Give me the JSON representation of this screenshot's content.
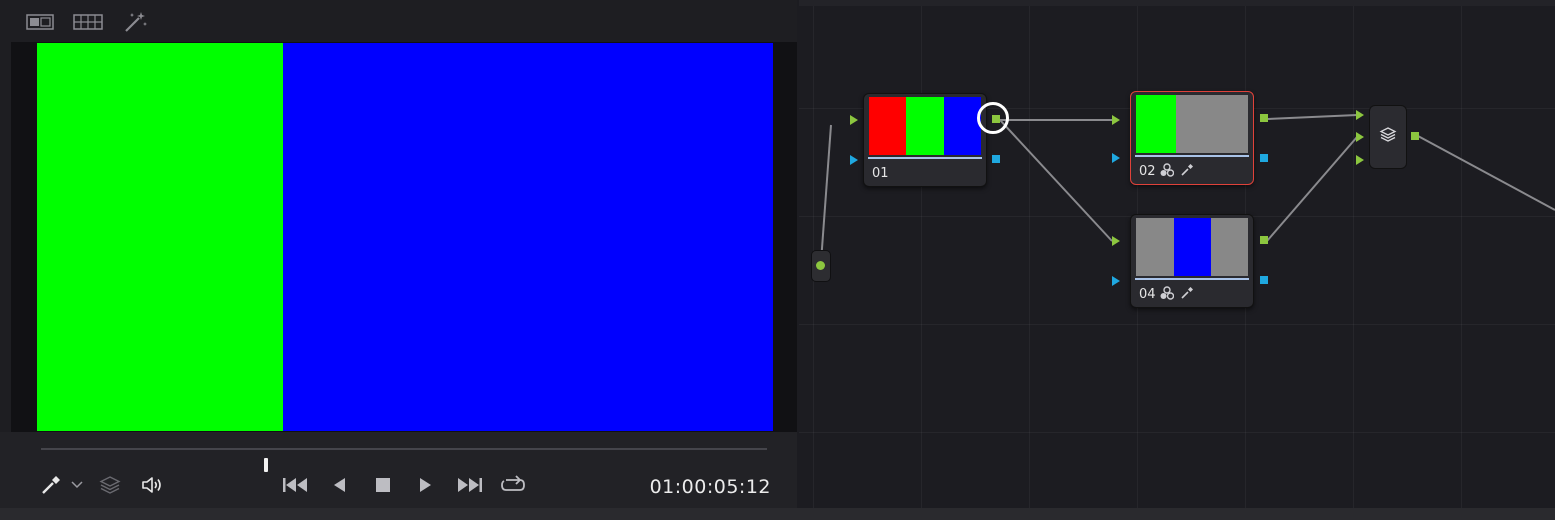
{
  "viewer": {
    "toolbar": {
      "icons": [
        "single-viewer-icon",
        "gallery-grid-icon",
        "magic-wand-icon"
      ]
    },
    "frame_colors": {
      "green": "#00ff00",
      "blue": "#0000ff"
    },
    "playhead_fraction": 0.31,
    "timecode": "01:00:05:12",
    "controls": {
      "icons": [
        "eyedropper-icon",
        "chevron-down-icon",
        "layers-icon",
        "audio-icon",
        "skip-to-start-icon",
        "reverse-play-icon",
        "stop-icon",
        "play-icon",
        "skip-to-end-icon",
        "loop-icon"
      ]
    }
  },
  "node_graph": {
    "nodes": [
      {
        "id": "01",
        "label": "01",
        "thumb": [
          "#ff0000",
          "#00ff00",
          "#0000ff"
        ],
        "selected": false
      },
      {
        "id": "02",
        "label": "02",
        "thumb": [
          "#00ff00",
          "#888888",
          "#888888"
        ],
        "selected": true,
        "icons": [
          "color-wheels-icon",
          "qualifier-eyedropper-icon"
        ]
      },
      {
        "id": "04",
        "label": "04",
        "thumb": [
          "#888888",
          "#0000ff",
          "#888888"
        ],
        "selected": false,
        "icons": [
          "color-wheels-icon",
          "qualifier-eyedropper-icon"
        ]
      }
    ],
    "layer_mixer": {
      "icon": "layer-mixer-icon"
    },
    "source_input": {
      "icon": "source-input-dot"
    },
    "colors": {
      "rgb_port": "#8cc63f",
      "alpha_port": "#1fa8e0",
      "wire": "#8a8a8e",
      "selection": "#e0423a"
    }
  }
}
